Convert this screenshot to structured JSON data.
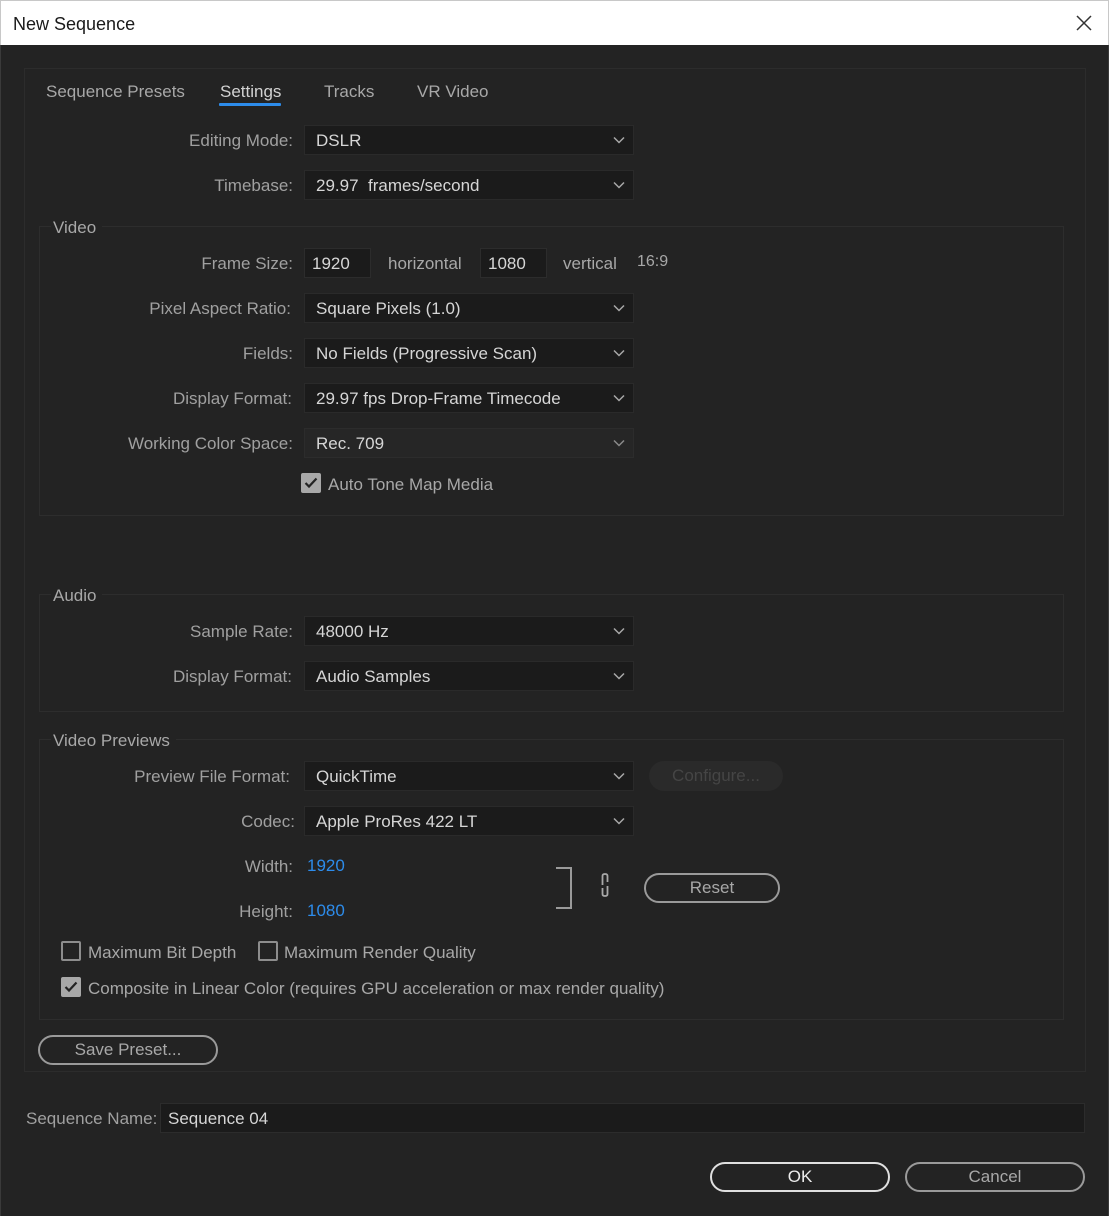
{
  "window": {
    "title": "New Sequence"
  },
  "tabs": [
    {
      "label": "Sequence Presets"
    },
    {
      "label": "Settings"
    },
    {
      "label": "Tracks"
    },
    {
      "label": "VR Video"
    }
  ],
  "general": {
    "editing_mode_label": "Editing Mode:",
    "editing_mode_value": "DSLR",
    "timebase_label": "Timebase:",
    "timebase_value": "29.97  frames/second"
  },
  "video": {
    "group_title": "Video",
    "frame_size_label": "Frame Size:",
    "frame_width": "1920",
    "horizontal_label": "horizontal",
    "frame_height": "1080",
    "vertical_label": "vertical",
    "aspect": "16:9",
    "pixel_aspect_label": "Pixel Aspect Ratio:",
    "pixel_aspect_value": "Square Pixels (1.0)",
    "fields_label": "Fields:",
    "fields_value": "No Fields (Progressive Scan)",
    "display_format_label": "Display Format:",
    "display_format_value": "29.97 fps Drop-Frame Timecode",
    "color_space_label": "Working Color Space:",
    "color_space_value": "Rec. 709",
    "auto_tone_map_label": "Auto Tone Map Media",
    "auto_tone_map_checked": true
  },
  "audio": {
    "group_title": "Audio",
    "sample_rate_label": "Sample Rate:",
    "sample_rate_value": "48000 Hz",
    "display_format_label": "Display Format:",
    "display_format_value": "Audio Samples"
  },
  "previews": {
    "group_title": "Video Previews",
    "file_format_label": "Preview File Format:",
    "file_format_value": "QuickTime",
    "configure_label": "Configure...",
    "codec_label": "Codec:",
    "codec_value": "Apple ProRes 422 LT",
    "width_label": "Width:",
    "width_value": "1920",
    "height_label": "Height:",
    "height_value": "1080",
    "reset_label": "Reset",
    "max_bit_depth_label": "Maximum Bit Depth",
    "max_render_quality_label": "Maximum Render Quality",
    "composite_linear_label": "Composite in Linear Color (requires GPU acceleration or max render quality)"
  },
  "footer": {
    "save_preset_label": "Save Preset...",
    "sequence_name_label": "Sequence Name:",
    "sequence_name_value": "Sequence 04",
    "ok_label": "OK",
    "cancel_label": "Cancel"
  },
  "colors": {
    "background": "#232323",
    "accent": "#2d8ceb",
    "field": "#1b1b1b"
  }
}
